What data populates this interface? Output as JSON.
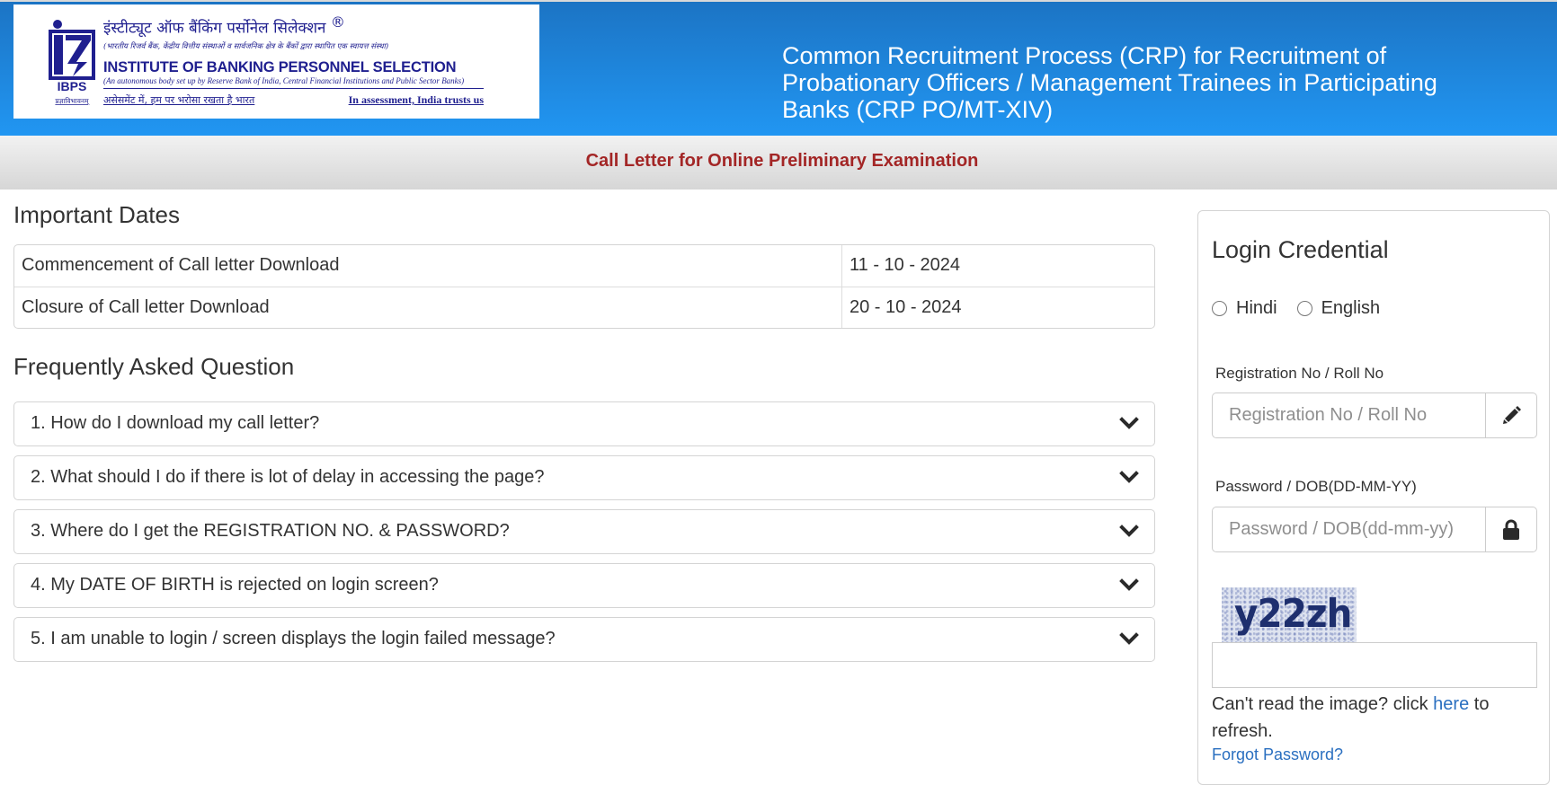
{
  "header": {
    "logo": {
      "mark_label": "IBPS",
      "mark_sub": "प्रज्ञाविभावनम्",
      "hindi_name": "इंस्टीट्यूट ऑफ बैंकिंग पर्सोनेल सिलेक्शन",
      "registered_mark": "®",
      "hindi_subtitle": "(भारतीय रिजर्व बैंक, केंद्रीय वित्तीय संस्थाओं व सार्वजनिक क्षेत्र के बैंकों द्वारा स्थापित एक स्वायत्त संस्था)",
      "english_name": "INSTITUTE OF BANKING PERSONNEL SELECTION",
      "english_subtitle": "(An autonomous body set up by Reserve Bank of India, Central Financial Institutions and Public Sector Banks)",
      "tagline_hindi": "असेसमेंट में, हम पर भरोसा रखता है भारत",
      "tagline_english": "In assessment, India trusts us"
    },
    "title": "Common Recruitment Process (CRP) for Recruitment of Probationary Officers / Management Trainees in Participating Banks (CRP PO/MT-XIV)",
    "subtitle": "Call Letter for Online Preliminary Examination"
  },
  "important_dates": {
    "heading": "Important Dates",
    "rows": [
      {
        "label": "Commencement of Call letter Download",
        "value": "11 - 10 - 2024"
      },
      {
        "label": "Closure of Call letter Download",
        "value": "20 - 10 - 2024"
      }
    ]
  },
  "faq": {
    "heading": "Frequently Asked Question",
    "items": [
      {
        "question": "1. How do I download my call letter?",
        "icon": "chevron-down-icon"
      },
      {
        "question": "2. What should I do if there is lot of delay in accessing the page?",
        "icon": "chevron-down-icon"
      },
      {
        "question": "3. Where do I get the REGISTRATION NO. & PASSWORD?",
        "icon": "chevron-down-icon"
      },
      {
        "question": "4. My DATE OF BIRTH is rejected on login screen?",
        "icon": "chevron-down-icon"
      },
      {
        "question": "5. I am unable to login / screen displays the login failed message?",
        "icon": "chevron-down-icon"
      }
    ]
  },
  "login": {
    "title": "Login Credential",
    "language_options": [
      {
        "label": "Hindi",
        "selected": false
      },
      {
        "label": "English",
        "selected": false
      }
    ],
    "registration": {
      "label": "Registration No / Roll No",
      "placeholder": "Registration No / Roll No",
      "value": "",
      "icon": "pencil-icon"
    },
    "password": {
      "label": "Password / DOB(DD-MM-YY)",
      "placeholder": "Password / DOB(dd-mm-yy)",
      "value": "",
      "icon": "lock-icon"
    },
    "captcha": {
      "image_text": "y22zh",
      "input_value": ""
    },
    "refresh_prefix": "Can't read the image? click ",
    "refresh_link": "here",
    "refresh_suffix": " to refresh.",
    "forgot_password": "Forgot Password?"
  },
  "colors": {
    "header_blue_top": "#1c74c4",
    "header_blue_bottom": "#2196f2",
    "subtitle_red": "#a32626",
    "link_blue": "#2a6fc0",
    "logo_navy": "#1f1f8f"
  }
}
